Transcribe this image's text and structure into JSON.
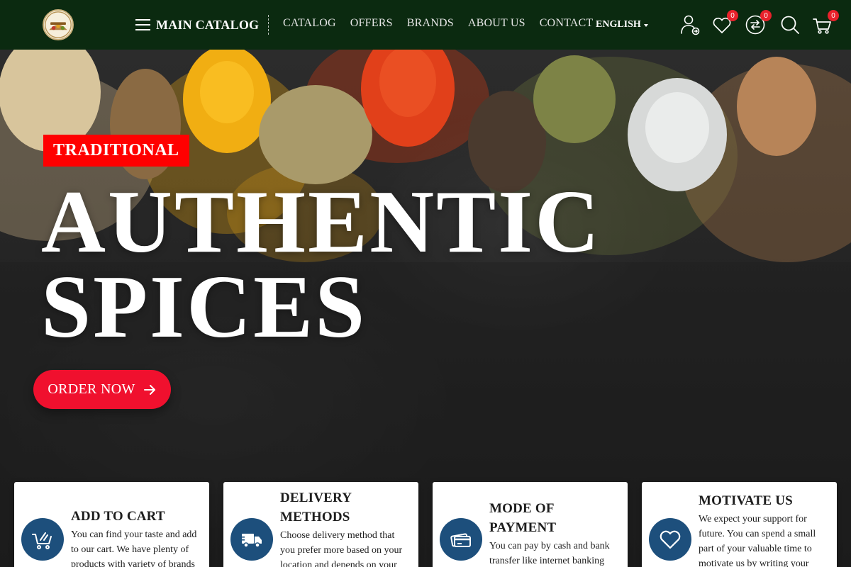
{
  "header": {
    "logo_icon": "spice-brand-logo",
    "main_catalog_label": "MAIN CATALOG",
    "nav": [
      "CATALOG",
      "OFFERS",
      "BRANDS",
      "ABOUT US",
      "CONTACT"
    ],
    "language": "ENGLISH",
    "icons": {
      "account": "user-account-icon",
      "wishlist": "heart-icon",
      "compare": "compare-arrows-icon",
      "search": "search-icon",
      "cart": "cart-icon"
    },
    "wishlist_count": "0",
    "compare_count": "0",
    "cart_count": "0"
  },
  "hero": {
    "tag": "TRADITIONAL",
    "title_line1": "AUTHENTIC",
    "title_line2": "SPICES",
    "cta_label": "ORDER NOW"
  },
  "features": [
    {
      "icon": "cart-icon",
      "title": "ADD TO CART",
      "text": "You can find your taste and add to our cart. We have plenty of products with variety of brands"
    },
    {
      "icon": "delivery-truck-icon",
      "title": "DELIVERY METHODS",
      "text": "Choose delivery method that you prefer more based on your location and depends on your"
    },
    {
      "icon": "payment-card-icon",
      "title": "MODE OF PAYMENT",
      "text": "You can pay by cash and bank transfer like internet banking system. We are using typical"
    },
    {
      "icon": "heart-icon",
      "title": "MOTIVATE US",
      "text": "We expect your support for future. You can spend a small part of your valuable time to motivate us by writing your"
    }
  ],
  "colors": {
    "header_bg": "#0b2a10",
    "accent_red": "#ff0000",
    "cta_red": "#f0102e",
    "feature_icon_bg": "#1d4f7c",
    "badge_red": "#e8212b"
  }
}
